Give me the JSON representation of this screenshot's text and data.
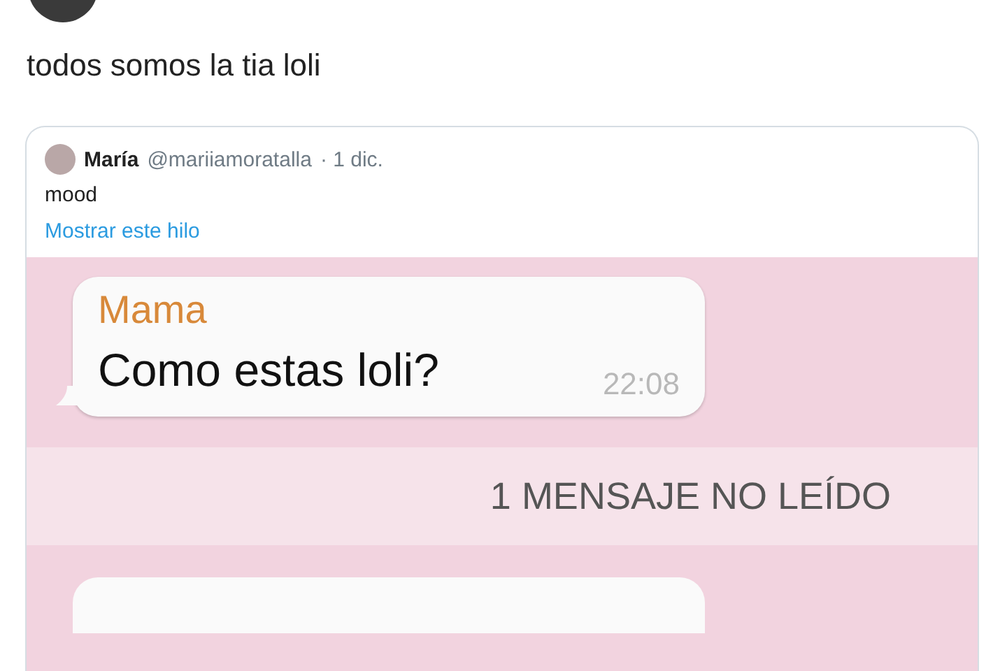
{
  "tweet": {
    "text": "todos somos la tia loli"
  },
  "quoted_tweet": {
    "name": "María",
    "handle": "@mariiamoratalla",
    "date": "· 1 dic.",
    "text": "mood",
    "link": "Mostrar este hilo",
    "chat": {
      "messages": [
        {
          "sender": "Mama",
          "text": "Como estas loli?",
          "time": "22:08"
        }
      ],
      "unread_banner": "1 MENSAJE NO LEÍDO"
    }
  }
}
